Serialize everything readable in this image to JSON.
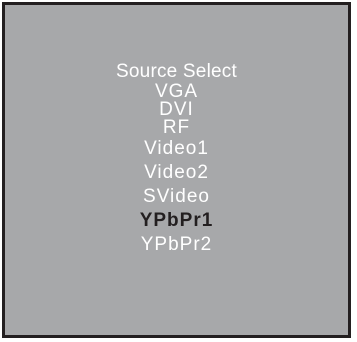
{
  "menu": {
    "title": "Source Select",
    "selected_index": 6,
    "items": [
      {
        "label": "VGA"
      },
      {
        "label": "DVI"
      },
      {
        "label": "RF"
      },
      {
        "label": "Video1"
      },
      {
        "label": "Video2"
      },
      {
        "label": "SVideo"
      },
      {
        "label": "YPbPr1"
      },
      {
        "label": "YPbPr2"
      }
    ]
  },
  "colors": {
    "panel_background": "#a7a8aa",
    "panel_border": "#231f20",
    "item_text": "#ffffff",
    "selected_text": "#231f20"
  }
}
